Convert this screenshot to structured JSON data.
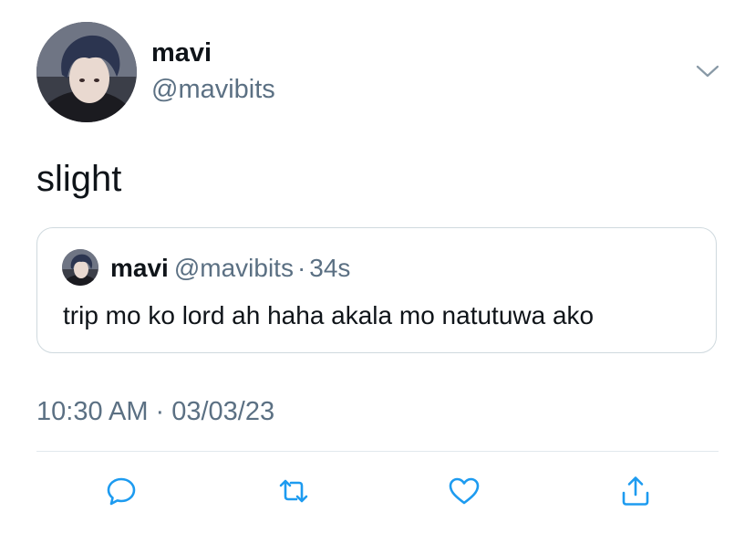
{
  "tweet": {
    "author": {
      "display_name": "mavi",
      "handle": "@mavibits"
    },
    "menu_icon": "chevron-down-icon",
    "text": "slight",
    "quoted": {
      "display_name": "mavi",
      "handle": "@mavibits",
      "separator": "·",
      "time": "34s",
      "text": "trip mo ko lord ah haha akala mo natutuwa ako"
    },
    "time": "10:30 AM",
    "separator": "·",
    "date": "03/03/23",
    "actions": [
      "reply-icon",
      "retweet-icon",
      "like-icon",
      "share-icon"
    ]
  },
  "colors": {
    "text_primary": "#0f1419",
    "text_secondary": "#5b7083",
    "border": "#cfd9de",
    "icon": "#1d9bf0"
  }
}
